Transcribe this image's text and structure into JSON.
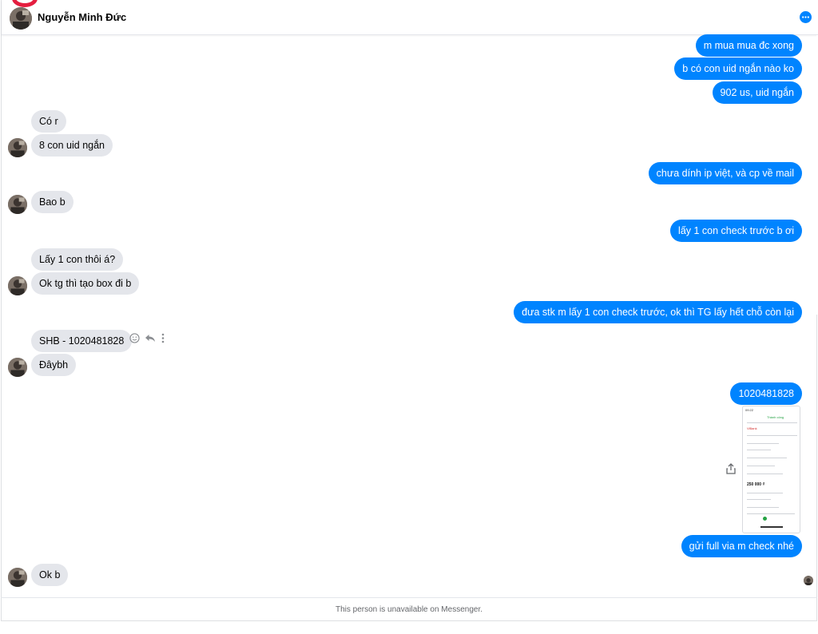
{
  "header": {
    "contact_name": "Nguyễn Minh Đức",
    "info_icon": "more-dots-icon"
  },
  "messages": {
    "out_1": "m mua mua đc xong",
    "out_2": "b có con uid ngắn nào ko",
    "out_3": "902 us, uid ngắn",
    "in_1": "Có r",
    "in_2": "8 con uid ngắn",
    "out_4": "chưa dính ip việt, và cp về mail",
    "in_3": "Bao b",
    "out_5": "lấy 1 con check trước b ơi",
    "in_4": "Lấy 1 con thôi á?",
    "in_5": "Ok tg thì tạo box đi b",
    "out_6": "đưa stk m lấy 1 con check trước, ok thì TG lấy hết chỗ còn lại",
    "in_6": "SHB - 1020481828",
    "in_7": "Đâybh",
    "out_7": "1020481828",
    "out_8": "gửi full via m check nhé",
    "in_8": "Ok b"
  },
  "receipt": {
    "status": "Thành công",
    "amount": "250 000 ₫",
    "bank": "ViBank"
  },
  "actions": {
    "react_icon": "smiley-icon",
    "reply_icon": "reply-icon",
    "more_icon": "vertical-dots-icon",
    "share_icon": "share-icon"
  },
  "footer": {
    "notice": "This person is unavailable on Messenger."
  },
  "colors": {
    "outgoing_bubble": "#0084ff",
    "incoming_bubble": "#e4e6eb",
    "accent_red": "#e41e3f"
  }
}
